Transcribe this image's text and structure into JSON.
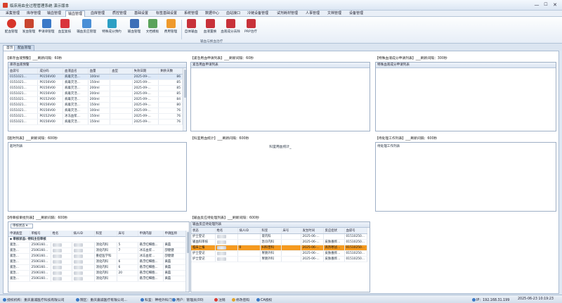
{
  "window": {
    "title": "临床用血全过程管理系统 演示版本",
    "min": "—",
    "max": "☐",
    "close": "✕"
  },
  "menu": [
    "采集管理",
    "库存管理",
    "输血管理",
    "输血管理",
    "血库管理",
    "质控管理",
    "基础设置",
    "标签基础设置",
    "系统管理",
    "数据中心",
    "血站接口",
    "冷链设备管理",
    "试剂耗材管理",
    "人事管理",
    "文档管理",
    "设备管理"
  ],
  "ribbon": {
    "buttons": [
      "配血管理",
      "发血管理",
      "申请单管理",
      "血型复核",
      "输血反应管理",
      "特殊成分预约",
      "输血管理",
      "文档模板",
      "费用管理",
      "自体输血",
      "血液置换",
      "血液成分去除",
      "PRP治疗"
    ],
    "group_label": "输血与换血治疗"
  },
  "tabs": [
    "首页",
    "配血管理"
  ],
  "panels": {
    "stock": {
      "title": "【库存血液预警】___刷新间隔：60秒",
      "box_title": "库存血液预警",
      "columns": [
        "血袋号",
        "成分码",
        "血液品名",
        "血量",
        "血型",
        "失效日期",
        "剩余天数"
      ],
      "rows": [
        [
          "0151021...",
          "P0156V00",
          "病毒灭活...",
          "100ml",
          "",
          "2025-09-...",
          "86"
        ],
        [
          "0151021...",
          "P0156V00",
          "病毒灭活...",
          "150ml",
          "",
          "2025-09-...",
          "85"
        ],
        [
          "0151021...",
          "P0156V00",
          "病毒灭活...",
          "200ml",
          "",
          "2025-09-...",
          "85"
        ],
        [
          "0151021...",
          "P0156V00",
          "病毒灭活...",
          "200ml",
          "",
          "2025-09-...",
          "85"
        ],
        [
          "0151021...",
          "P0152V00",
          "病毒灭活...",
          "200ml",
          "",
          "2025-09-...",
          "84"
        ],
        [
          "0151021...",
          "P0156V00",
          "病毒灭活...",
          "150ml",
          "",
          "2025-09-...",
          "80"
        ],
        [
          "0151021...",
          "P0156V00",
          "病毒灭活...",
          "100ml",
          "",
          "2025-09-...",
          "76"
        ],
        [
          "0151021...",
          "P0152V00",
          "冰冻血浆...",
          "150ml",
          "",
          "2025-09-...",
          "76"
        ],
        [
          "0151021...",
          "P0156V00",
          "病毒灭活...",
          "150ml",
          "",
          "2025-09-...",
          "76"
        ]
      ]
    },
    "emergency": {
      "title": "【紧急用血申请列表】___刷新间隔：60秒",
      "box_title": "紧急用血申请列表"
    },
    "special": {
      "title": "【特殊血液成分申请列表】___刷新间隔：300秒",
      "box_title": "特殊血液成分申请列表"
    },
    "overdue": {
      "title": "【超时列表】___刷新间隔：600秒",
      "box_title": "超时列表"
    },
    "dept_stats": {
      "title": "【科室用血统计】___刷新间隔：600秒",
      "box_title": "科室用血统计_"
    },
    "pending": {
      "title": "【待处理工作列表】___刷新间隔：600秒",
      "box_title": "待处理工作列表"
    },
    "review": {
      "title": "【待审核审批列表】___刷新间隔：600秒",
      "filter": "审核状态",
      "columns": [
        "申请类型",
        "单据号",
        "姓名",
        "病人ID",
        "科室",
        "床号",
        "申请内容",
        "申请医师"
      ],
      "group_row": "审核状态: 待科主任审核",
      "rows": [
        [
          "紧急...",
          "2506160...",
          "",
          "",
          "消化内科",
          "5",
          "悬浮红细胞...",
          "黄磊"
        ],
        [
          "紧急...",
          "2506160...",
          "",
          "",
          "消化内科",
          "7",
          "冰冻血浆...",
          "卲健健"
        ],
        [
          "紧急...",
          "2506160...",
          "",
          "",
          "重症医学科",
          "",
          "冰冻血浆...",
          "卲健健"
        ],
        [
          "紧急...",
          "2506160...",
          "",
          "",
          "消化内科",
          "6",
          "悬浮红细胞...",
          "黄磊"
        ],
        [
          "紧急...",
          "2506160...",
          "",
          "",
          "消化内科",
          "6",
          "悬浮红细胞...",
          "黄磊"
        ],
        [
          "紧急...",
          "2506160...",
          "",
          "",
          "消化内科",
          "20",
          "悬浮红细胞...",
          "黄磊"
        ],
        [
          "紧急...",
          "2506160...",
          "",
          "",
          "消化内科",
          "",
          "悬浮红细胞...",
          "黄磊"
        ]
      ]
    },
    "reaction": {
      "title": "【输血反应待处理列表】___刷新间隔：600秒",
      "box_title": "输血反应待处理列表",
      "columns": [
        "状态",
        "姓名",
        "病人ID",
        "科室",
        "床号",
        "发生时间",
        "反应症状",
        "血袋号"
      ],
      "rows": [
        [
          "护士登记",
          "",
          "",
          "肾内科",
          "",
          "2025-06-...",
          "",
          "01510250..."
        ],
        [
          "输血科审核",
          "",
          "",
          "急诊内科",
          "",
          "2025-06-...",
          "皮肤瘙痒...",
          "01510250..."
        ],
        [
          "临床上报",
          "",
          "0",
          "妇科普科",
          "",
          "2025-06-...",
          "高热寒战...",
          "01510250..."
        ],
        [
          "护士登记",
          "",
          "",
          "胃肠外科",
          "",
          "2025-06-...",
          "皮肤瘙痒...",
          "01510250..."
        ],
        [
          "护士登记",
          "",
          "",
          "胃肠外科",
          "",
          "2025-06-...",
          "皮肤瘙痒...",
          "01510250..."
        ]
      ]
    }
  },
  "status": {
    "org": "授权机构：重庆嘉诚医疗科技有限公司",
    "site": "院区：重庆嘉诚医疗有限公司...",
    "dept": "科室：神经外科门诊",
    "user": "用户：管理员(00)",
    "logout": "注销",
    "change_pwd": "修改密码",
    "ca": "CA授权",
    "ip": "IP：192.168.31.199",
    "datetime": "2025-06-23 10:19:23"
  },
  "colors": {
    "highlight_row": "#f59a1f",
    "accent": "#2f6cc1"
  }
}
